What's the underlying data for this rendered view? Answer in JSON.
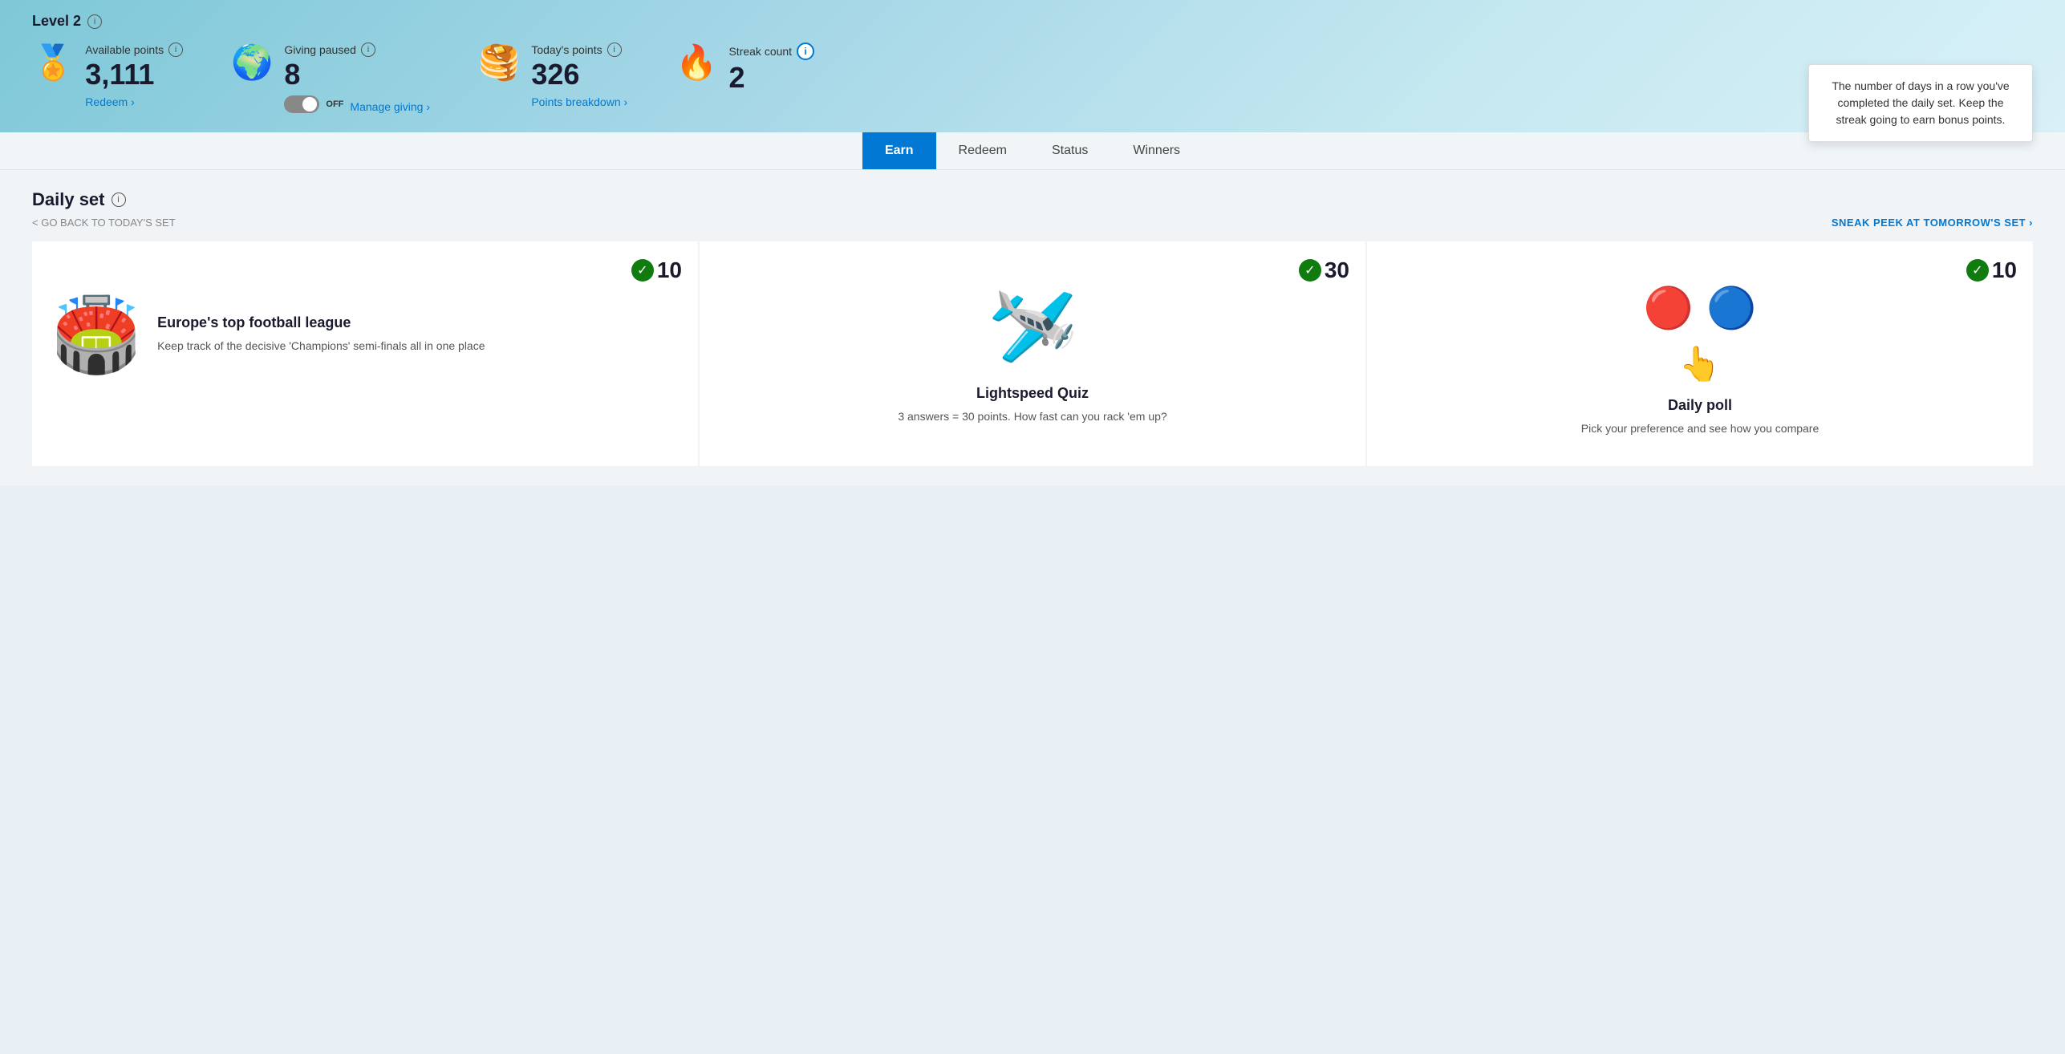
{
  "level": {
    "text": "Level 2",
    "info_icon": "ⓘ"
  },
  "stats": {
    "available_points": {
      "icon": "🏅",
      "label": "Available points",
      "value": "3,111",
      "action": "Redeem ›"
    },
    "giving": {
      "icon": "🌍",
      "label": "Giving paused",
      "value": "8",
      "toggle": "OFF",
      "action": "Manage giving ›"
    },
    "todays_points": {
      "icon": "🥞",
      "label": "Today's points",
      "value": "326",
      "action": "Points breakdown ›"
    },
    "streak": {
      "icon": "🔥",
      "label": "Streak count",
      "value": "2"
    }
  },
  "tooltip": {
    "text": "The number of days in a row you've completed the daily set. Keep the streak going to earn bonus points."
  },
  "nav": {
    "tabs": [
      {
        "label": "Earn",
        "active": true
      },
      {
        "label": "Redeem",
        "active": false
      },
      {
        "label": "Status",
        "active": false
      },
      {
        "label": "Winners",
        "active": false
      }
    ]
  },
  "daily_set": {
    "title": "Daily set",
    "nav_back": "< GO BACK TO TODAY'S SET",
    "nav_forward": "SNEAK PEEK AT TOMORROW'S SET ›"
  },
  "cards": [
    {
      "points": "10",
      "completed": true,
      "title": "Europe's top football league",
      "description": "Keep track of the decisive 'Champions' semi-finals all in one place",
      "type": "football"
    },
    {
      "points": "30",
      "completed": true,
      "title": "Lightspeed Quiz",
      "description": "3 answers = 30 points. How fast can you rack 'em up?",
      "type": "quiz"
    },
    {
      "points": "10",
      "completed": true,
      "title": "Daily poll",
      "description": "Pick your preference and see how you compare",
      "type": "poll"
    }
  ]
}
